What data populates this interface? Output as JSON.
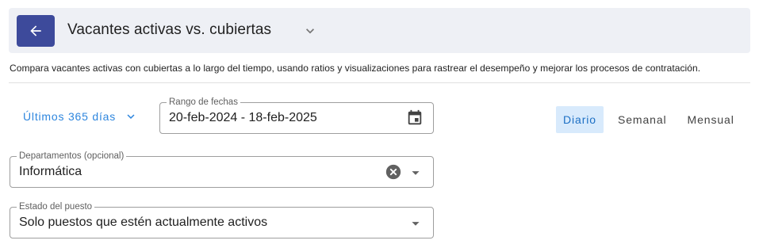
{
  "header": {
    "title": "Vacantes activas vs. cubiertas",
    "back_icon": "arrow-left-icon",
    "chevron_icon": "chevron-down-icon"
  },
  "description": "Compara vacantes activas con cubiertas a lo largo del tiempo, usando ratios y visualizaciones para rastrear el desempeño y mejorar los procesos de contratación.",
  "period": {
    "label": "Últimos 365 días"
  },
  "date_range": {
    "label": "Rango de fechas",
    "value": "20-feb-2024 - 18-feb-2025",
    "icon": "calendar-icon"
  },
  "granularity": {
    "options": [
      "Diario",
      "Semanal",
      "Mensual"
    ],
    "selected": "Diario"
  },
  "departments": {
    "label": "Departamentos (opcional)",
    "value": "Informática"
  },
  "job_status": {
    "label": "Estado del puesto",
    "value": "Solo puestos que estén actualmente activos"
  },
  "colors": {
    "primary": "#3d4a9b",
    "accent": "#2e86de",
    "header_bg": "#eef0f5",
    "toggle_active_bg": "#d8eafc"
  }
}
